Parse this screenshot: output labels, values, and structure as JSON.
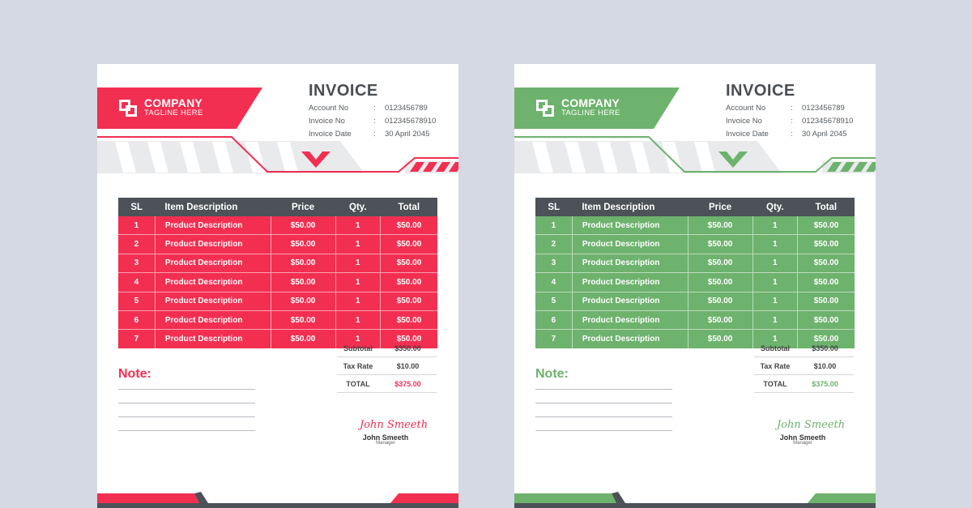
{
  "invoices": [
    {
      "accent": "#f22f51",
      "company": "COMPANY",
      "tagline": "TAGLINE HERE",
      "title": "INVOICE",
      "meta": [
        {
          "label": "Account No",
          "sep": ":",
          "value": "0123456789"
        },
        {
          "label": "Invoice No",
          "sep": ":",
          "value": "012345678910"
        },
        {
          "label": "Invoice Date",
          "sep": ":",
          "value": "30 April 2045"
        }
      ],
      "headers": [
        "SL",
        "Item Description",
        "Price",
        "Qty.",
        "Total"
      ],
      "rows": [
        [
          "1",
          "Product Description",
          "$50.00",
          "1",
          "$50.00"
        ],
        [
          "2",
          "Product Description",
          "$50.00",
          "1",
          "$50.00"
        ],
        [
          "3",
          "Product Description",
          "$50.00",
          "1",
          "$50.00"
        ],
        [
          "4",
          "Product Description",
          "$50.00",
          "1",
          "$50.00"
        ],
        [
          "5",
          "Product Description",
          "$50.00",
          "1",
          "$50.00"
        ],
        [
          "6",
          "Product Description",
          "$50.00",
          "1",
          "$50.00"
        ],
        [
          "7",
          "Product Description",
          "$50.00",
          "1",
          "$50.00"
        ]
      ],
      "totals": [
        {
          "label": "Subtotal",
          "value": "$350.00"
        },
        {
          "label": "Tax Rate",
          "value": "$10.00"
        },
        {
          "label": "TOTAL",
          "value": "$375.00"
        }
      ],
      "note_title": "Note:",
      "signature": "John Smeeth",
      "signer_name": "John Smeeth",
      "signer_role": "Manager"
    },
    {
      "accent": "#6db26d",
      "company": "COMPANY",
      "tagline": "TAGLINE HERE",
      "title": "INVOICE",
      "meta": [
        {
          "label": "Account No",
          "sep": ":",
          "value": "0123456789"
        },
        {
          "label": "Invoice No",
          "sep": ":",
          "value": "012345678910"
        },
        {
          "label": "Invoice Date",
          "sep": ":",
          "value": "30 April 2045"
        }
      ],
      "headers": [
        "SL",
        "Item Description",
        "Price",
        "Qty.",
        "Total"
      ],
      "rows": [
        [
          "1",
          "Product Description",
          "$50.00",
          "1",
          "$50.00"
        ],
        [
          "2",
          "Product Description",
          "$50.00",
          "1",
          "$50.00"
        ],
        [
          "3",
          "Product Description",
          "$50.00",
          "1",
          "$50.00"
        ],
        [
          "4",
          "Product Description",
          "$50.00",
          "1",
          "$50.00"
        ],
        [
          "5",
          "Product Description",
          "$50.00",
          "1",
          "$50.00"
        ],
        [
          "6",
          "Product Description",
          "$50.00",
          "1",
          "$50.00"
        ],
        [
          "7",
          "Product Description",
          "$50.00",
          "1",
          "$50.00"
        ]
      ],
      "totals": [
        {
          "label": "Subtotal",
          "value": "$350.00"
        },
        {
          "label": "Tax Rate",
          "value": "$10.00"
        },
        {
          "label": "TOTAL",
          "value": "$375.00"
        }
      ],
      "note_title": "Note:",
      "signature": "John Smeeth",
      "signer_name": "John Smeeth",
      "signer_role": "Manager"
    }
  ]
}
